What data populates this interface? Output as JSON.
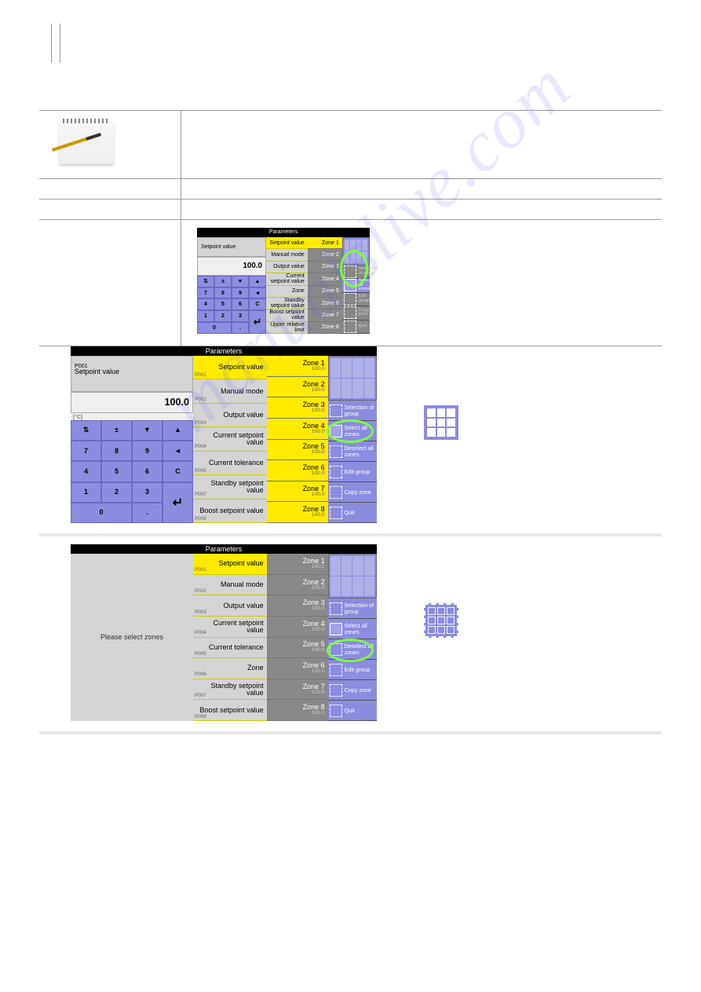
{
  "watermark": "manualslive.com",
  "titlebar": "Parameters",
  "keypad": {
    "label": "Setpoint value",
    "value": "100.0",
    "unit": "[°C]",
    "placeholder_msg": "Please select zones",
    "keys_row1": [
      "⇅",
      "±",
      "▼",
      "▲"
    ],
    "keys": [
      "7",
      "8",
      "9",
      "◄",
      "4",
      "5",
      "6",
      "C",
      "1",
      "2",
      "3",
      "",
      "0",
      "",
      "."
    ]
  },
  "params": [
    {
      "id": "P001",
      "label": "Setpoint value"
    },
    {
      "id": "P002",
      "label": "Manual mode"
    },
    {
      "id": "P003",
      "label": "Output value"
    },
    {
      "id": "P004",
      "label": "Current setpoint value"
    },
    {
      "id": "P005",
      "label": "Current tolerance"
    },
    {
      "id": "P006",
      "label": "Zone"
    },
    {
      "id": "P007",
      "label": "Standby setpoint value"
    },
    {
      "id": "P008",
      "label": "Boost setpoint value"
    }
  ],
  "params_small": [
    {
      "id": "",
      "label": "Setpoint value"
    },
    {
      "id": "",
      "label": "Manual mode"
    },
    {
      "id": "",
      "label": "Output value"
    },
    {
      "id": "",
      "label": "Current setpoint value"
    },
    {
      "id": "",
      "label": "Zone"
    },
    {
      "id": "",
      "label": "Standby setpoint value"
    },
    {
      "id": "",
      "label": "Boost setpoint value"
    },
    {
      "id": "",
      "label": "Upper relative limit"
    }
  ],
  "zones": [
    {
      "name": "Zone 1",
      "val": "100.0"
    },
    {
      "name": "Zone 2",
      "val": "100.0"
    },
    {
      "name": "Zone 3",
      "val": "100.0"
    },
    {
      "name": "Zone 4",
      "val": "100.0"
    },
    {
      "name": "Zone 5",
      "val": "100.0"
    },
    {
      "name": "Zone 6",
      "val": "100.0"
    },
    {
      "name": "Zone 7",
      "val": "100.0"
    },
    {
      "name": "Zone 8",
      "val": "100.0"
    }
  ],
  "actions": {
    "selection_of_group": "Selection of group",
    "select_all": "Select all zones",
    "deselect_all": "Deselect all zones",
    "edit_group": "Edit group",
    "copy_zone": "Copy zone",
    "quit": "Quit"
  }
}
